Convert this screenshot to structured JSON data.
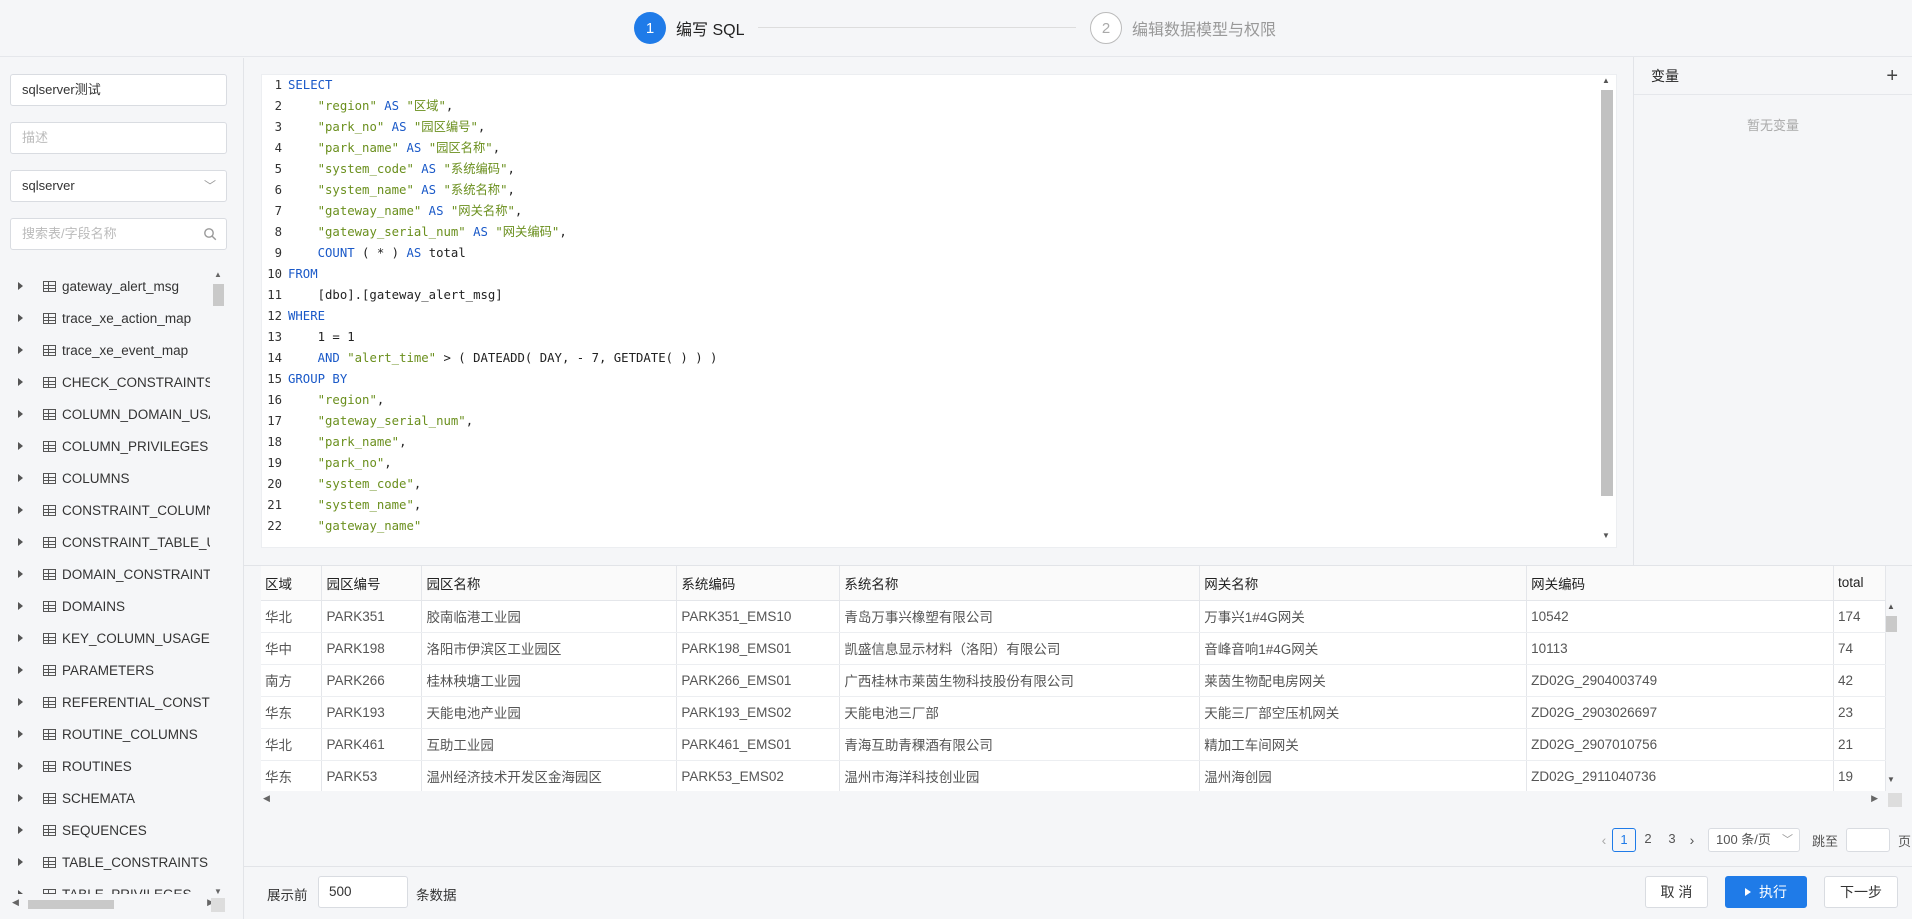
{
  "steps": [
    {
      "num": "1",
      "label": "编写 SQL"
    },
    {
      "num": "2",
      "label": "编辑数据模型与权限"
    }
  ],
  "left": {
    "name_value": "sqlserver测试",
    "desc_placeholder": "描述",
    "db_value": "sqlserver",
    "search_placeholder": "搜索表/字段名称",
    "tables": [
      "gateway_alert_msg",
      "trace_xe_action_map",
      "trace_xe_event_map",
      "CHECK_CONSTRAINTS",
      "COLUMN_DOMAIN_USAGE",
      "COLUMN_PRIVILEGES",
      "COLUMNS",
      "CONSTRAINT_COLUMN_USAGE",
      "CONSTRAINT_TABLE_USAGE",
      "DOMAIN_CONSTRAINTS",
      "DOMAINS",
      "KEY_COLUMN_USAGE",
      "PARAMETERS",
      "REFERENTIAL_CONSTRAINTS",
      "ROUTINE_COLUMNS",
      "ROUTINES",
      "SCHEMATA",
      "SEQUENCES",
      "TABLE_CONSTRAINTS",
      "TABLE_PRIVILEGES"
    ]
  },
  "sql_lines": [
    [
      {
        "t": "kw",
        "v": "SELECT"
      }
    ],
    [
      {
        "t": "p",
        "v": "    "
      },
      {
        "t": "str",
        "v": "\"region\""
      },
      {
        "t": "kw",
        "v": " AS "
      },
      {
        "t": "str",
        "v": "\"区域\""
      },
      {
        "t": "p",
        "v": ","
      }
    ],
    [
      {
        "t": "p",
        "v": "    "
      },
      {
        "t": "str",
        "v": "\"park_no\""
      },
      {
        "t": "kw",
        "v": " AS "
      },
      {
        "t": "str",
        "v": "\"园区编号\""
      },
      {
        "t": "p",
        "v": ","
      }
    ],
    [
      {
        "t": "p",
        "v": "    "
      },
      {
        "t": "str",
        "v": "\"park_name\""
      },
      {
        "t": "kw",
        "v": " AS "
      },
      {
        "t": "str",
        "v": "\"园区名称\""
      },
      {
        "t": "p",
        "v": ","
      }
    ],
    [
      {
        "t": "p",
        "v": "    "
      },
      {
        "t": "str",
        "v": "\"system_code\""
      },
      {
        "t": "kw",
        "v": " AS "
      },
      {
        "t": "str",
        "v": "\"系统编码\""
      },
      {
        "t": "p",
        "v": ","
      }
    ],
    [
      {
        "t": "p",
        "v": "    "
      },
      {
        "t": "str",
        "v": "\"system_name\""
      },
      {
        "t": "kw",
        "v": " AS "
      },
      {
        "t": "str",
        "v": "\"系统名称\""
      },
      {
        "t": "p",
        "v": ","
      }
    ],
    [
      {
        "t": "p",
        "v": "    "
      },
      {
        "t": "str",
        "v": "\"gateway_name\""
      },
      {
        "t": "kw",
        "v": " AS "
      },
      {
        "t": "str",
        "v": "\"网关名称\""
      },
      {
        "t": "p",
        "v": ","
      }
    ],
    [
      {
        "t": "p",
        "v": "    "
      },
      {
        "t": "str",
        "v": "\"gateway_serial_num\""
      },
      {
        "t": "kw",
        "v": " AS "
      },
      {
        "t": "str",
        "v": "\"网关编码\""
      },
      {
        "t": "p",
        "v": ","
      }
    ],
    [
      {
        "t": "p",
        "v": "    "
      },
      {
        "t": "kw",
        "v": "COUNT"
      },
      {
        "t": "p",
        "v": " ( * ) "
      },
      {
        "t": "kw",
        "v": "AS"
      },
      {
        "t": "p",
        "v": " total"
      }
    ],
    [
      {
        "t": "kw",
        "v": "FROM"
      }
    ],
    [
      {
        "t": "p",
        "v": "    [dbo].[gateway_alert_msg]"
      }
    ],
    [
      {
        "t": "kw",
        "v": "WHERE"
      }
    ],
    [
      {
        "t": "p",
        "v": "    1 = 1"
      }
    ],
    [
      {
        "t": "p",
        "v": "    "
      },
      {
        "t": "kw",
        "v": "AND"
      },
      {
        "t": "p",
        "v": " "
      },
      {
        "t": "str",
        "v": "\"alert_time\""
      },
      {
        "t": "p",
        "v": " > ( DATEADD( DAY, - 7, GETDATE( ) ) )"
      }
    ],
    [
      {
        "t": "kw",
        "v": "GROUP BY"
      }
    ],
    [
      {
        "t": "p",
        "v": "    "
      },
      {
        "t": "str",
        "v": "\"region\""
      },
      {
        "t": "p",
        "v": ","
      }
    ],
    [
      {
        "t": "p",
        "v": "    "
      },
      {
        "t": "str",
        "v": "\"gateway_serial_num\""
      },
      {
        "t": "p",
        "v": ","
      }
    ],
    [
      {
        "t": "p",
        "v": "    "
      },
      {
        "t": "str",
        "v": "\"park_name\""
      },
      {
        "t": "p",
        "v": ","
      }
    ],
    [
      {
        "t": "p",
        "v": "    "
      },
      {
        "t": "str",
        "v": "\"park_no\""
      },
      {
        "t": "p",
        "v": ","
      }
    ],
    [
      {
        "t": "p",
        "v": "    "
      },
      {
        "t": "str",
        "v": "\"system_code\""
      },
      {
        "t": "p",
        "v": ","
      }
    ],
    [
      {
        "t": "p",
        "v": "    "
      },
      {
        "t": "str",
        "v": "\"system_name\""
      },
      {
        "t": "p",
        "v": ","
      }
    ],
    [
      {
        "t": "p",
        "v": "    "
      },
      {
        "t": "str",
        "v": "\"gateway_name\""
      }
    ]
  ],
  "vars": {
    "title": "变量",
    "add": "+",
    "empty": "暂无变量"
  },
  "results": {
    "columns": [
      "区域",
      "园区编号",
      "园区名称",
      "系统编码",
      "系统名称",
      "网关名称",
      "网关编码",
      "total"
    ],
    "rows": [
      [
        "华北",
        "PARK351",
        "胶南临港工业园",
        "PARK351_EMS10",
        "青岛万事兴橡塑有限公司",
        "万事兴1#4G网关",
        "10542",
        "174"
      ],
      [
        "华中",
        "PARK198",
        "洛阳市伊滨区工业园区",
        "PARK198_EMS01",
        "凯盛信息显示材料（洛阳）有限公司",
        "音峰音响1#4G网关",
        "10113",
        "74"
      ],
      [
        "南方",
        "PARK266",
        "桂林秧塘工业园",
        "PARK266_EMS01",
        "广西桂林市莱茵生物科技股份有限公司",
        "莱茵生物配电房网关",
        "ZD02G_2904003749",
        "42"
      ],
      [
        "华东",
        "PARK193",
        "天能电池产业园",
        "PARK193_EMS02",
        "天能电池三厂部",
        "天能三厂部空压机网关",
        "ZD02G_2903026697",
        "23"
      ],
      [
        "华北",
        "PARK461",
        "互助工业园",
        "PARK461_EMS01",
        "青海互助青稞酒有限公司",
        "精加工车间网关",
        "ZD02G_2907010756",
        "21"
      ],
      [
        "华东",
        "PARK53",
        "温州经济技术开发区金海园区",
        "PARK53_EMS02",
        "温州市海洋科技创业园",
        "温州海创园",
        "ZD02G_2911040736",
        "19"
      ]
    ]
  },
  "pager": {
    "prev": "‹",
    "next": "›",
    "pages": [
      "1",
      "2",
      "3"
    ],
    "size": "100 条/页",
    "jump": "跳至",
    "unit": "页"
  },
  "footer": {
    "pre": "展示前",
    "rows_value": "500",
    "post": "条数据",
    "cancel": "取 消",
    "run": "执行",
    "next": "下一步"
  }
}
